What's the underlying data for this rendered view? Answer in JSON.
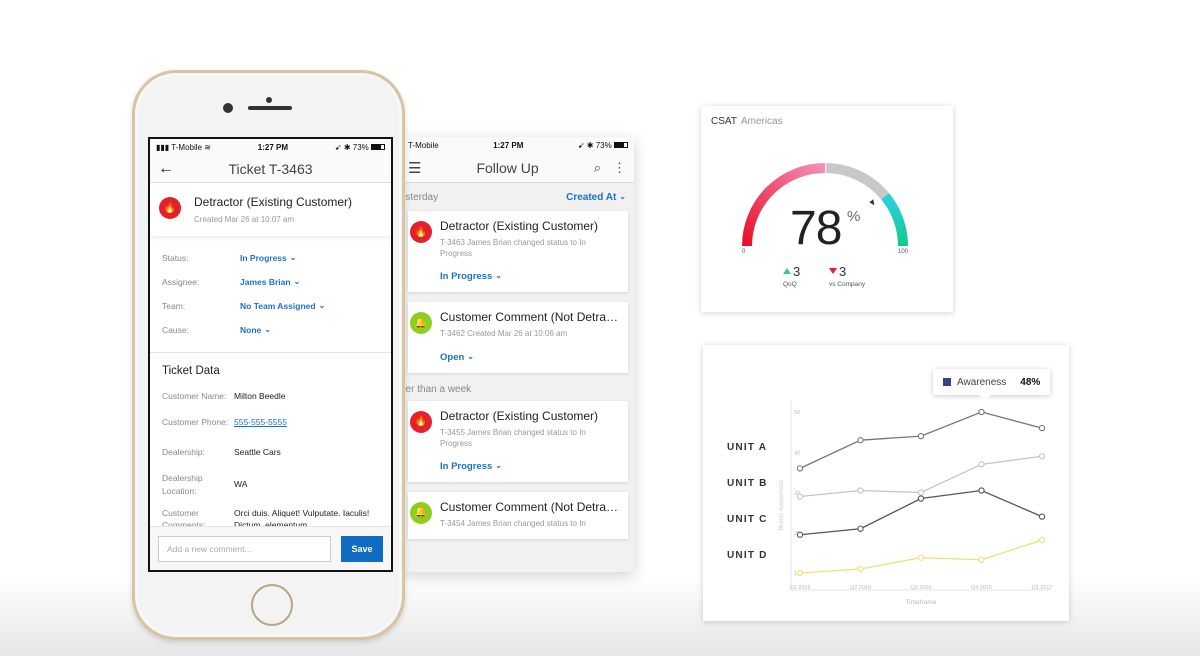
{
  "colors": {
    "link_blue": "#1a73c8",
    "save_button": "#0f6cc0",
    "detractor_red": "#e3202b",
    "comment_green": "#8ccf1e",
    "tooltip_swatch": "#3b4478",
    "gauge_red": "#e8102a",
    "gauge_pink": "#f58fb8",
    "gauge_gray": "#c8c8c8",
    "gauge_cyan": "#2ad0e0",
    "gauge_teal": "#14c98e"
  },
  "status_bar": {
    "carrier": "T-Mobile",
    "time": "1:27 PM",
    "battery": "73%"
  },
  "ticket_screen": {
    "title": "Ticket T-3463",
    "header": {
      "icon": "flame-icon",
      "title": "Detractor (Existing Customer)",
      "created": "Created Mar 26 at 10:07 am"
    },
    "fields": [
      {
        "label": "Status:",
        "value": "In Progress"
      },
      {
        "label": "Assignee:",
        "value": "James Brian"
      },
      {
        "label": "Team:",
        "value": "No Team Assigned"
      },
      {
        "label": "Cause:",
        "value": "None"
      }
    ],
    "ticket_data_title": "Ticket Data",
    "ticket_data": [
      {
        "label": "Customer Name:",
        "value": "Milton Beedle"
      },
      {
        "label": "Customer Phone:",
        "value": "555-555-5555"
      },
      {
        "label": "Dealership:",
        "value": "Seattle Cars"
      },
      {
        "label": "Dealership Location:",
        "value": "WA"
      },
      {
        "label": "Customer Comments:",
        "value": "Orci duis. Aliquet! Vulputate. Iaculis! Dictum, elementum."
      }
    ],
    "comment_placeholder": "Add a new comment...",
    "save_label": "Save"
  },
  "follow_up_screen": {
    "title": "Follow Up",
    "sort_label": "Created At",
    "sections": [
      {
        "label": "Yesterday",
        "items": [
          {
            "type": "detractor",
            "title": "Detractor (Existing Customer)",
            "subtitle": "T-3463 James Brian changed status to In Progress",
            "status": "In Progress"
          },
          {
            "type": "comment",
            "title": "Customer Comment (Not Detrac...",
            "subtitle": "T-3462 Created Mar 26 at 10:06 am",
            "status": "Open"
          }
        ]
      },
      {
        "label": "Older than a week",
        "items": [
          {
            "type": "detractor",
            "title": "Detractor (Existing Customer)",
            "subtitle": "T-3455 James Brian changed status to In Progress",
            "status": "In Progress"
          },
          {
            "type": "comment",
            "title": "Customer Comment (Not Detrac...",
            "subtitle": "T-3454 James Brian changed status to In",
            "status": ""
          }
        ]
      }
    ]
  },
  "csat": {
    "title": "CSAT",
    "region": "Americas",
    "value": "78",
    "value_num": 78,
    "unit": "%",
    "min_label": "0",
    "max_label": "100",
    "marker_value": 78,
    "deltas": [
      {
        "direction": "up",
        "value": "3",
        "label": "QoQ"
      },
      {
        "direction": "down",
        "value": "3",
        "label": "vs Company"
      }
    ]
  },
  "chart_data": {
    "type": "line",
    "title": "",
    "xlabel": "Timeframe",
    "ylabel": "Brand Awareness",
    "x": [
      "Q1 2016",
      "Q2 2016",
      "Q3 2016",
      "Q4 2016",
      "Q1 2017"
    ],
    "ylim": [
      10,
      50
    ],
    "yticks": [
      10,
      20,
      30,
      40,
      50
    ],
    "grid": false,
    "legend": "left",
    "series": [
      {
        "name": "UNIT A",
        "values": [
          36,
          43,
          44,
          50,
          46
        ],
        "color": "#777777"
      },
      {
        "name": "UNIT B",
        "values": [
          29,
          30.5,
          30,
          37,
          39
        ],
        "color": "#c4c4c4"
      },
      {
        "name": "UNIT C",
        "values": [
          19.5,
          21,
          28.5,
          30.5,
          24
        ],
        "color": "#555555"
      },
      {
        "name": "UNIT D",
        "values": [
          10,
          11,
          13.8,
          13.3,
          18.2
        ],
        "color": "#ece27a"
      }
    ],
    "tooltip": {
      "label": "Awareness",
      "value": "48%",
      "series": "UNIT A",
      "x": "Q4 2016"
    }
  }
}
